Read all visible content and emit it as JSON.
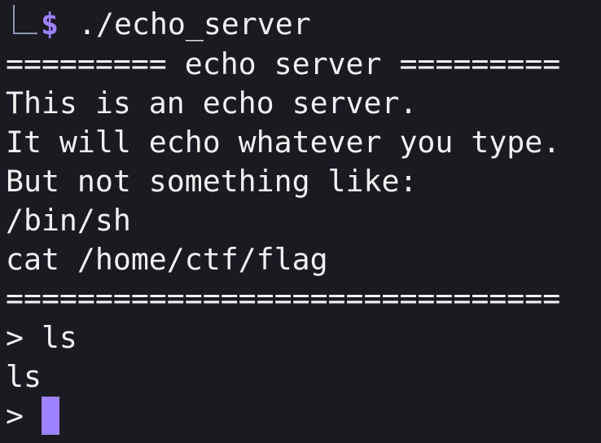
{
  "terminal": {
    "prompt_symbol": "$",
    "command": "./echo_server",
    "lines": [
      "========= echo server =========",
      "This is an echo server.",
      "It will echo whatever you type.",
      "But not something like:",
      "/bin/sh",
      "cat /home/ctf/flag",
      "===============================",
      "> ls",
      "ls",
      "> "
    ]
  }
}
